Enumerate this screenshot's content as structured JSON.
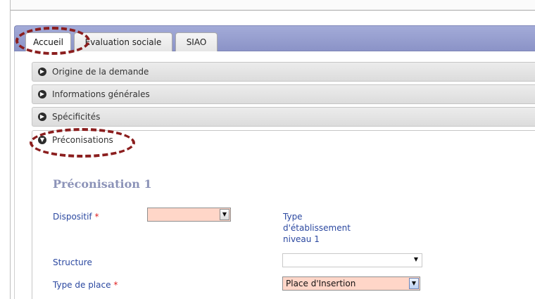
{
  "tabs": [
    {
      "label": "Accueil"
    },
    {
      "label": "Evaluation sociale"
    },
    {
      "label": "SIAO"
    }
  ],
  "accordion": [
    {
      "label": "Origine de la demande"
    },
    {
      "label": "Informations générales"
    },
    {
      "label": "Spécificités"
    },
    {
      "label": "Préconisations"
    }
  ],
  "section": {
    "title": "Préconisation 1"
  },
  "form": {
    "dispositif_label": "Dispositif",
    "required_mark": "*",
    "dispositif_value": "",
    "type_label": "Type d'établissement niveau 1",
    "structure_label": "Structure",
    "structure_value": "",
    "type_place_label": "Type de place",
    "type_place_value": "Place d'Insertion"
  },
  "colors": {
    "tabbar": "#8b93c7",
    "required_field": "#ffd6c8",
    "label_blue": "#2b48a0",
    "annotation": "#8b1e1e"
  },
  "icons": [
    "circle-arrow-right-icon",
    "circle-arrow-down-icon",
    "dropdown-arrow-icon"
  ]
}
